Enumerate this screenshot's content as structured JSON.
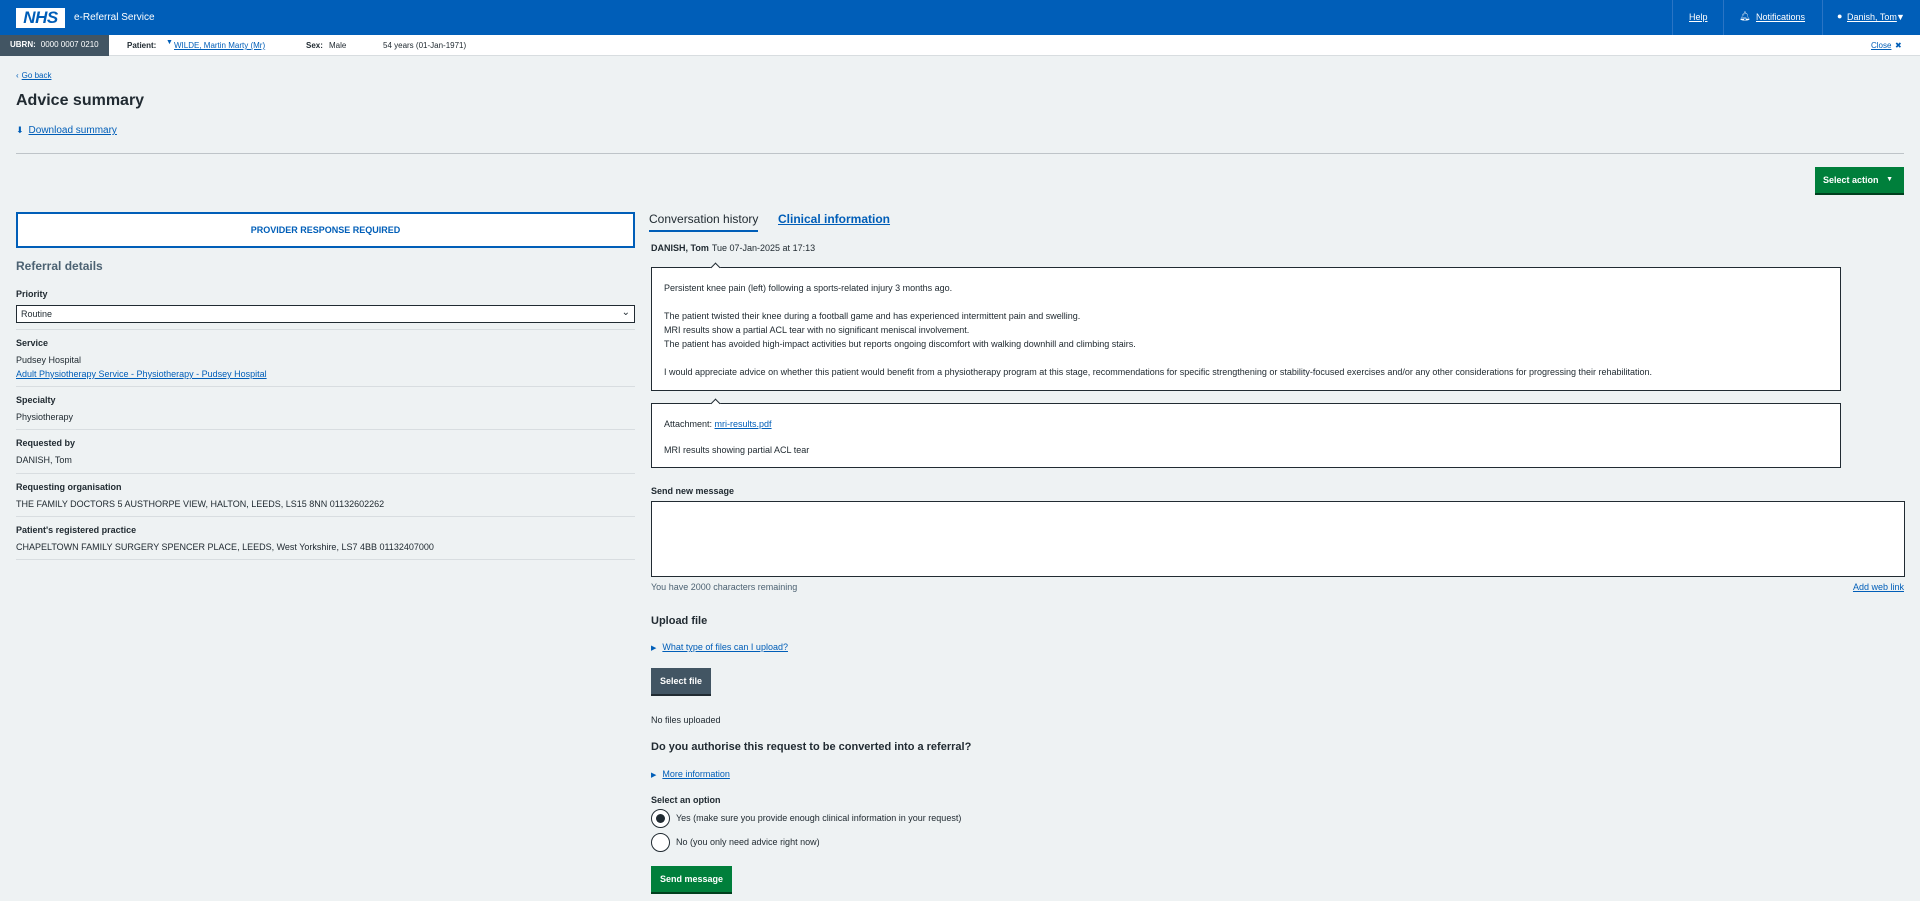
{
  "header": {
    "logo": "NHS",
    "service_name": "e-Referral Service",
    "help": "Help",
    "notifications": "Notifications",
    "user": "Danish, Tom"
  },
  "banner": {
    "ubrn_label": "UBRN:",
    "ubrn_value": "0000 0007 0210",
    "patient_label": "Patient:",
    "patient_name": "WILDE, Martin Marty (Mr)",
    "sex_label": "Sex:",
    "sex_value": "Male",
    "age": "54 years (01-Jan-1971)",
    "close": "Close"
  },
  "page": {
    "go_back": "Go back",
    "title": "Advice summary",
    "download": "Download summary",
    "select_action": "Select action"
  },
  "left": {
    "provider_status": "PROVIDER RESPONSE REQUIRED",
    "referral_heading": "Referral details",
    "priority_label": "Priority",
    "priority_value": "Routine",
    "service_label": "Service",
    "service_org": "Pudsey Hospital",
    "service_link": "Adult Physiotherapy Service - Physiotherapy - Pudsey Hospital",
    "specialty_label": "Specialty",
    "specialty_value": "Physiotherapy",
    "requested_by_label": "Requested by",
    "requested_by_value": "DANISH, Tom",
    "req_org_label": "Requesting organisation",
    "req_org_value": "THE FAMILY DOCTORS 5 AUSTHORPE VIEW, HALTON, LEEDS, LS15 8NN 01132602262",
    "practice_label": "Patient's registered practice",
    "practice_value": "CHAPELTOWN FAMILY SURGERY SPENCER PLACE, LEEDS, West Yorkshire, LS7 4BB 01132407000"
  },
  "tabs": {
    "conversation": "Conversation history",
    "clinical": "Clinical information"
  },
  "message": {
    "author": "DANISH, Tom",
    "timestamp": "Tue 07-Jan-2025 at 17:13",
    "line1": "Persistent knee pain (left) following a sports-related injury 3 months ago.",
    "line2": "The patient twisted their knee during a football game and has experienced intermittent pain and swelling.",
    "line3": "MRI results show a partial ACL tear with no significant meniscal involvement.",
    "line4": "The patient has avoided high-impact activities but reports ongoing discomfort with walking downhill and climbing stairs.",
    "line5": "I would appreciate advice on whether this patient would benefit from a physiotherapy program at this stage, recommendations for specific strengthening or stability-focused exercises and/or any other considerations for progressing their rehabilitation.",
    "attachment_label": "Attachment:",
    "attachment_file": "mri-results.pdf",
    "attachment_desc": "MRI results showing partial ACL tear"
  },
  "compose": {
    "label": "Send new message",
    "chars_remaining": "You have 2000 characters remaining",
    "add_web_link": "Add web link",
    "upload_heading": "Upload file",
    "file_types_link": "What type of files can I upload?",
    "select_file": "Select file",
    "no_files": "No files uploaded",
    "authorise_question": "Do you authorise this request to be converted into a referral?",
    "more_info": "More information",
    "option_label": "Select an option",
    "option_yes": "Yes (make sure you provide enough clinical information in your request)",
    "option_no": "No (you only need advice right now)",
    "selected": "yes",
    "send": "Send message"
  },
  "colors": {
    "nhs_blue": "#005eb8",
    "green": "#007f3b",
    "grey_button": "#425563",
    "page_bg": "#eef2f3"
  }
}
